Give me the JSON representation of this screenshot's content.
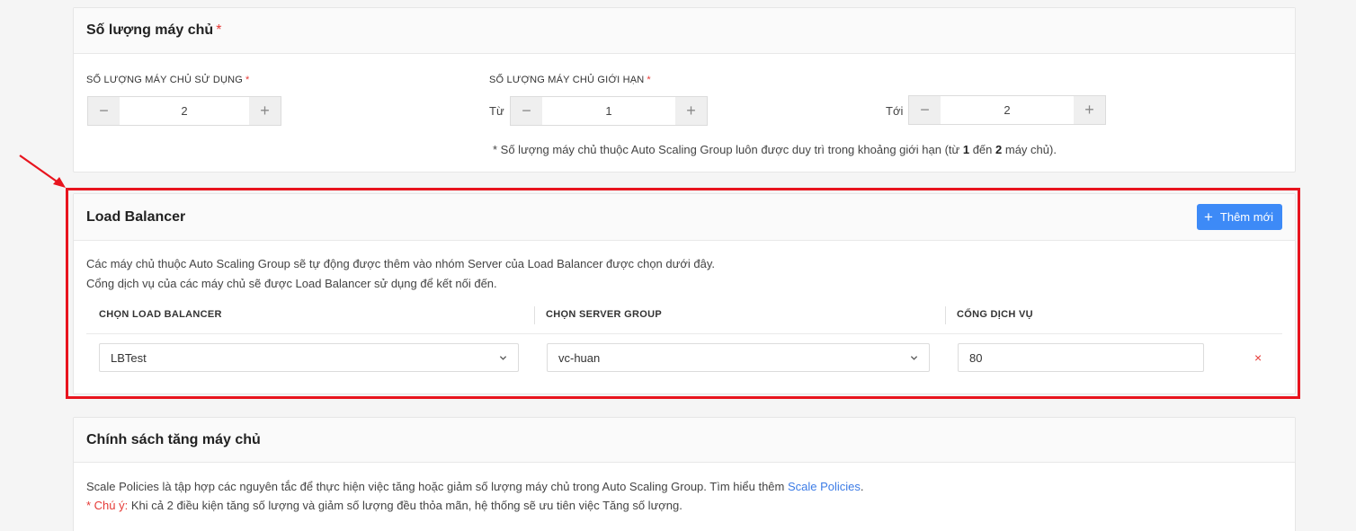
{
  "servers": {
    "title": "Số lượng máy chủ",
    "required_mark": "*",
    "used_label": "SỐ LƯỢNG MÁY CHỦ SỬ DỤNG",
    "used_value": "2",
    "limit_label": "SỐ LƯỢNG MÁY CHỦ GIỚI HẠN",
    "from_label": "Từ",
    "from_value": "1",
    "to_label": "Tới",
    "to_value": "2",
    "minus_symbol": "−",
    "plus_symbol": "+",
    "hint_prefix": "* Số lượng máy chủ thuộc Auto Scaling Group luôn được duy trì trong khoảng giới hạn (từ ",
    "hint_min": "1",
    "hint_mid": " đến ",
    "hint_max": "2",
    "hint_suffix": " máy chủ)."
  },
  "load_balancer": {
    "title": "Load Balancer",
    "add_button": "Thêm mới",
    "add_icon": "plus-icon",
    "desc_line1": "Các máy chủ thuộc Auto Scaling Group sẽ tự động được thêm vào nhóm Server của Load Balancer được chọn dưới đây.",
    "desc_line2": "Cổng dịch vụ của các máy chủ sẽ được Load Balancer sử dụng để kết nối đến.",
    "columns": [
      "CHỌN LOAD BALANCER",
      "CHỌN SERVER GROUP",
      "CỔNG DỊCH VỤ"
    ],
    "row": {
      "load_balancer": "LBTest",
      "server_group": "vc-huan",
      "port": "80",
      "remove_symbol": "×"
    },
    "highlight_color": "#e8141e"
  },
  "policy": {
    "title": "Chính sách tăng máy chủ",
    "line1_text": "Scale Policies là tập hợp các nguyên tắc để thực hiện việc tăng hoặc giảm số lượng máy chủ trong Auto Scaling Group. Tìm hiểu thêm ",
    "line1_link": "Scale Policies",
    "line1_end": ".",
    "note_label": "* Chú ý:",
    "note_text": " Khi cả 2 điều kiện tăng số lượng và giảm số lượng đều thỏa mãn, hệ thống sẽ ưu tiên việc Tăng số lượng."
  },
  "colors": {
    "primary": "#3d8af7",
    "danger": "#e53935",
    "link": "#3d7ce6"
  }
}
